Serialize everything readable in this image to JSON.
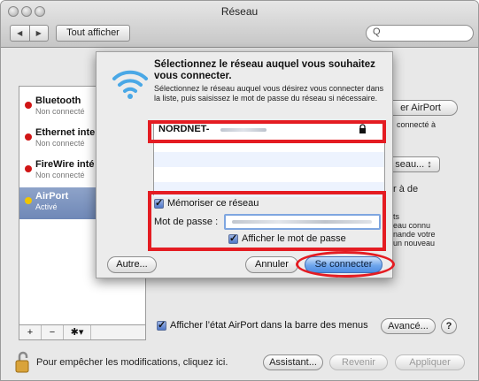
{
  "window": {
    "title": "Réseau"
  },
  "toolbar": {
    "back": "◀",
    "forward": "▶",
    "show_all": "Tout afficher",
    "search_glyph": "Q"
  },
  "sidebar": {
    "items": [
      {
        "name": "Bluetooth",
        "status": "Non connecté"
      },
      {
        "name": "Ethernet inte",
        "status": "Non connecté"
      },
      {
        "name": "FireWire inté",
        "status": "Non connecté"
      },
      {
        "name": "AirPort",
        "status": "Activé"
      }
    ],
    "add": "+",
    "remove": "−",
    "gear": "✱▾"
  },
  "panel": {
    "airport_button": "er AirPort",
    "connected_fragment": "connecté à",
    "network_popup": "seau...",
    "ask_fragment": "r à de",
    "info_lines": [
      "ts",
      "eau connu",
      "nande votre",
      "un nouveau"
    ],
    "show_airport_menu": "Afficher l’état AirPort dans la barre des menus",
    "advanced": "Avancé...",
    "help": "?"
  },
  "footer": {
    "lock_text": "Pour empêcher les modifications, cliquez ici.",
    "assistant": "Assistant...",
    "revert": "Revenir",
    "apply": "Appliquer"
  },
  "dialog": {
    "title": "Sélectionnez le réseau auquel vous souhaitez vous connecter.",
    "instructions": "Sélectionnez le réseau auquel vous désirez vous connecter dans la liste, puis saisissez le mot de passe du réseau si nécessaire.",
    "networks": [
      {
        "name": "NORDNET-"
      }
    ],
    "remember_label": "Mémoriser ce réseau",
    "password_label": "Mot de passe :",
    "show_password_label": "Afficher le mot de passe",
    "other_button": "Autre...",
    "cancel_button": "Annuler",
    "connect_button": "Se connecter"
  },
  "colors": {
    "highlight": "#e41c22",
    "selection": "#6f88b7",
    "status_off": "#d01515",
    "status_on": "#f0c500",
    "accent": "#4f8de3"
  }
}
